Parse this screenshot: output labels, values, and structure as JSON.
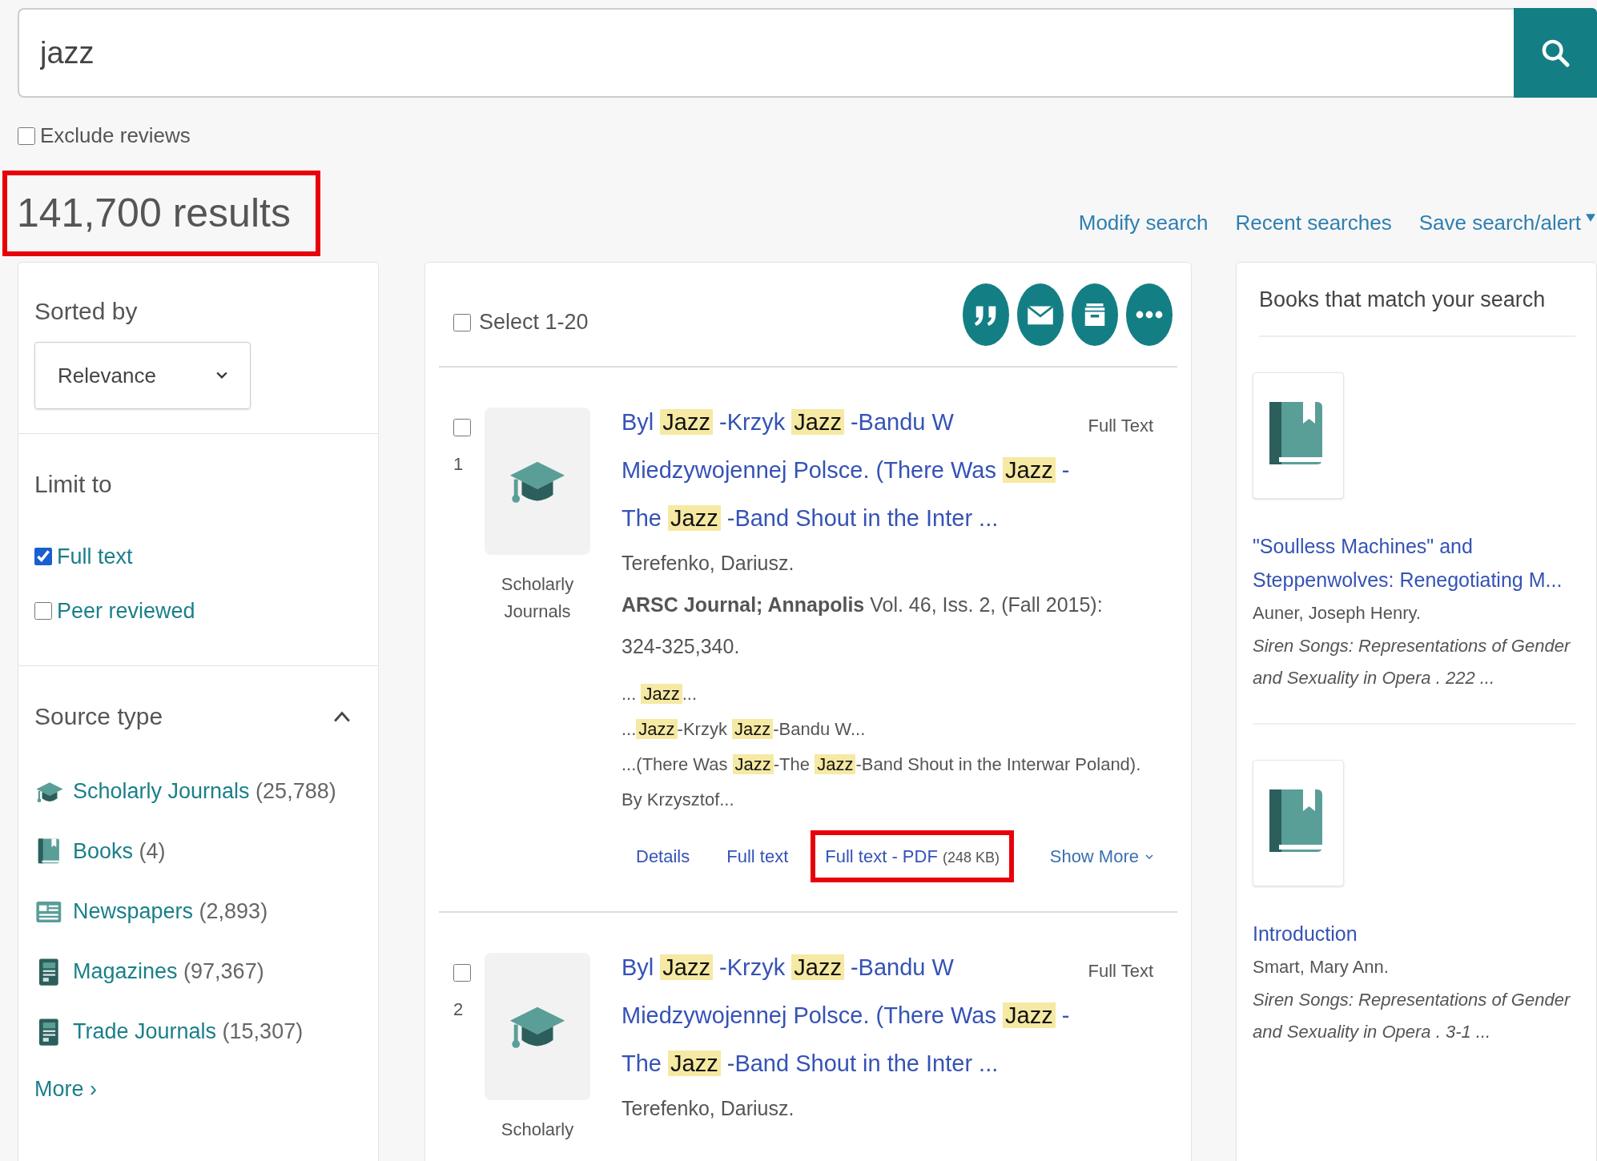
{
  "search": {
    "value": "jazz"
  },
  "exclude_reviews": {
    "label": "Exclude reviews",
    "checked": false
  },
  "results_count": {
    "text": "141,700 results",
    "highlighted": true
  },
  "search_links": [
    {
      "label": "Modify search",
      "kind": "link"
    },
    {
      "label": "Recent searches",
      "kind": "link"
    },
    {
      "label": "Save search/alert",
      "kind": "dropdown"
    }
  ],
  "sort": {
    "label": "Sorted by",
    "value": "Relevance"
  },
  "limit": {
    "heading": "Limit to",
    "options": [
      {
        "label": "Full text",
        "checked": true
      },
      {
        "label": "Peer reviewed",
        "checked": false
      }
    ]
  },
  "source_type": {
    "heading": "Source type",
    "expanded": true,
    "items": [
      {
        "kind": "scholarly",
        "label": "Scholarly Journals",
        "count": "(25,788)"
      },
      {
        "kind": "book",
        "label": "Books",
        "count": "(4)"
      },
      {
        "kind": "newspaper",
        "label": "Newspapers",
        "count": "(2,893)"
      },
      {
        "kind": "magazine",
        "label": "Magazines",
        "count": "(97,367)"
      },
      {
        "kind": "magazine",
        "label": "Trade Journals",
        "count": "(15,307)"
      }
    ],
    "more": {
      "label": "More",
      "arrow": "›"
    }
  },
  "results": {
    "select_label": "Select 1-20",
    "select_all": false,
    "items": [
      {
        "number": "1",
        "checked": false,
        "kind": "scholarly",
        "type": "Scholarly Journals",
        "availability": "Full Text",
        "title": [
          {
            "text": "Byl ",
            "hit": false
          },
          {
            "text": "Jazz",
            "hit": true
          },
          {
            "text": " -Krzyk ",
            "hit": false
          },
          {
            "text": "Jazz",
            "hit": true
          },
          {
            "text": " -Bandu W Miedzywojennej Polsce. (There Was ",
            "hit": false
          },
          {
            "text": "Jazz",
            "hit": true
          },
          {
            "text": " -The ",
            "hit": false
          },
          {
            "text": "Jazz",
            "hit": true
          },
          {
            "text": " -Band Shout in the Inter ...",
            "hit": false
          }
        ],
        "author": "Terefenko, Dariusz.",
        "source": "**ARSC Journal; Annapolis** Vol. 46, Iss. 2,  (Fall 2015): 324-325,340.",
        "snippet": [
          [
            {
              "text": "...  ",
              "hit": false
            },
            {
              "text": "Jazz",
              "hit": true
            },
            {
              "text": "...",
              "hit": false
            }
          ],
          [
            {
              "text": "...",
              "hit": false
            },
            {
              "text": "Jazz",
              "hit": true
            },
            {
              "text": "-Krzyk ",
              "hit": false
            },
            {
              "text": "Jazz",
              "hit": true
            },
            {
              "text": "-Bandu W...",
              "hit": false
            }
          ],
          [
            {
              "text": "...(There Was ",
              "hit": false
            },
            {
              "text": "Jazz",
              "hit": true
            },
            {
              "text": "-The ",
              "hit": false
            },
            {
              "text": "Jazz",
              "hit": true
            },
            {
              "text": "-Band Shout in the Interwar Poland). By Krzysztof...",
              "hit": false
            }
          ]
        ],
        "links": [
          {
            "label": "Details",
            "highlighted": false
          },
          {
            "label": "Full text",
            "highlighted": false
          },
          {
            "label": "Full text - PDF",
            "size": "(248 KB)",
            "highlighted": true
          }
        ],
        "show_more": "Show More"
      },
      {
        "number": "2",
        "checked": false,
        "kind": "scholarly",
        "type": "Scholarly",
        "availability": "Full Text",
        "title": [
          {
            "text": "Byl ",
            "hit": false
          },
          {
            "text": "Jazz",
            "hit": true
          },
          {
            "text": " -Krzyk ",
            "hit": false
          },
          {
            "text": "Jazz",
            "hit": true
          },
          {
            "text": " -Bandu W Miedzywojennej Polsce. (There Was ",
            "hit": false
          },
          {
            "text": "Jazz",
            "hit": true
          },
          {
            "text": " -The ",
            "hit": false
          },
          {
            "text": "Jazz",
            "hit": true
          },
          {
            "text": " -Band Shout in the Inter ...",
            "hit": false
          }
        ],
        "author": "Terefenko, Dariusz."
      }
    ]
  },
  "books": {
    "heading": "Books that match your search",
    "items": [
      {
        "title": "\"Soulless Machines\" and Steppenwolves: Renegotiating M...",
        "author": "Auner, Joseph Henry.",
        "source": "Siren Songs: Representations of Gender and Sexuality in Opera . 222 ..."
      },
      {
        "title": "Introduction",
        "author": "Smart, Mary Ann.",
        "source": "Siren Songs: Representations of Gender and Sexuality in Opera . 3-1  ..."
      }
    ]
  }
}
